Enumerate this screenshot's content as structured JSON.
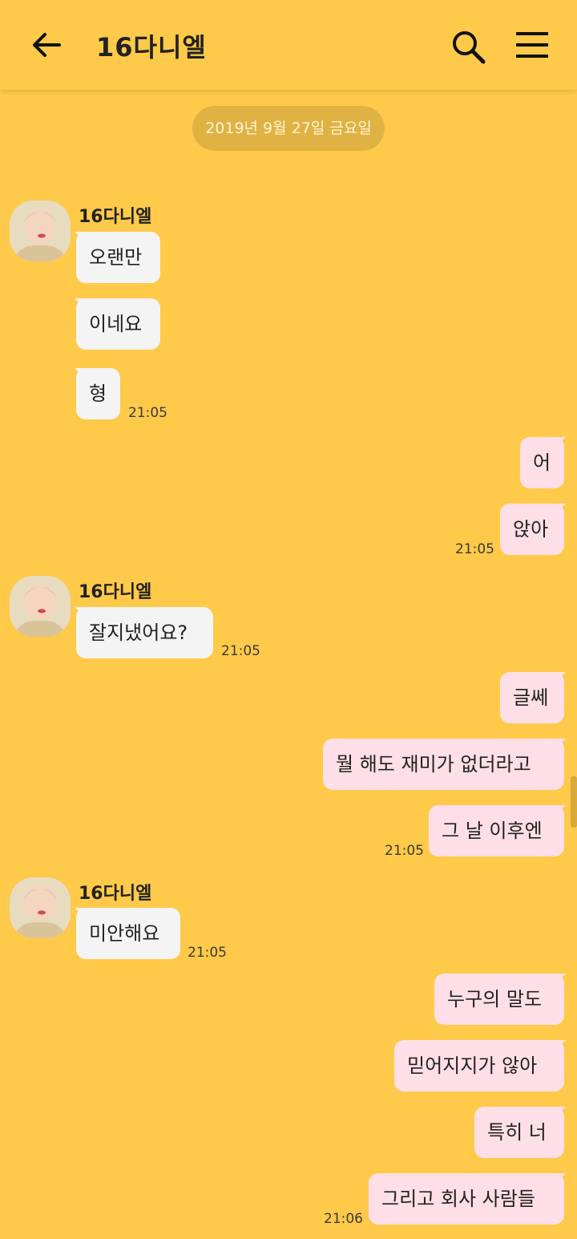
{
  "header": {
    "title": "16다니엘",
    "back_icon": "arrow-left-icon",
    "search_icon": "search-icon",
    "menu_icon": "hamburger-menu-icon"
  },
  "date_divider": "2019년 9월 27일 금요일",
  "colors": {
    "background": "#ffc94a",
    "incoming_bubble": "#f4f4f4",
    "outgoing_bubble": "#ffdfe7"
  },
  "messages": [
    {
      "sender": "16다니엘",
      "text": "오랜만"
    },
    {
      "text": "이네요"
    },
    {
      "text": "형",
      "time": "21:05"
    },
    {
      "text": "어"
    },
    {
      "text": "앉아",
      "time": "21:05"
    },
    {
      "sender": "16다니엘",
      "text": "잘지냈어요?",
      "time": "21:05"
    },
    {
      "text": "글쎄"
    },
    {
      "text": "뭘 해도 재미가 없더라고"
    },
    {
      "text": "그 날 이후엔",
      "time": "21:05"
    },
    {
      "sender": "16다니엘",
      "text": "미안해요",
      "time": "21:05"
    },
    {
      "text": "누구의 말도"
    },
    {
      "text": "믿어지지가 않아"
    },
    {
      "text": "특히 너"
    },
    {
      "text": "그리고 회사 사람들",
      "time": "21:06"
    }
  ]
}
